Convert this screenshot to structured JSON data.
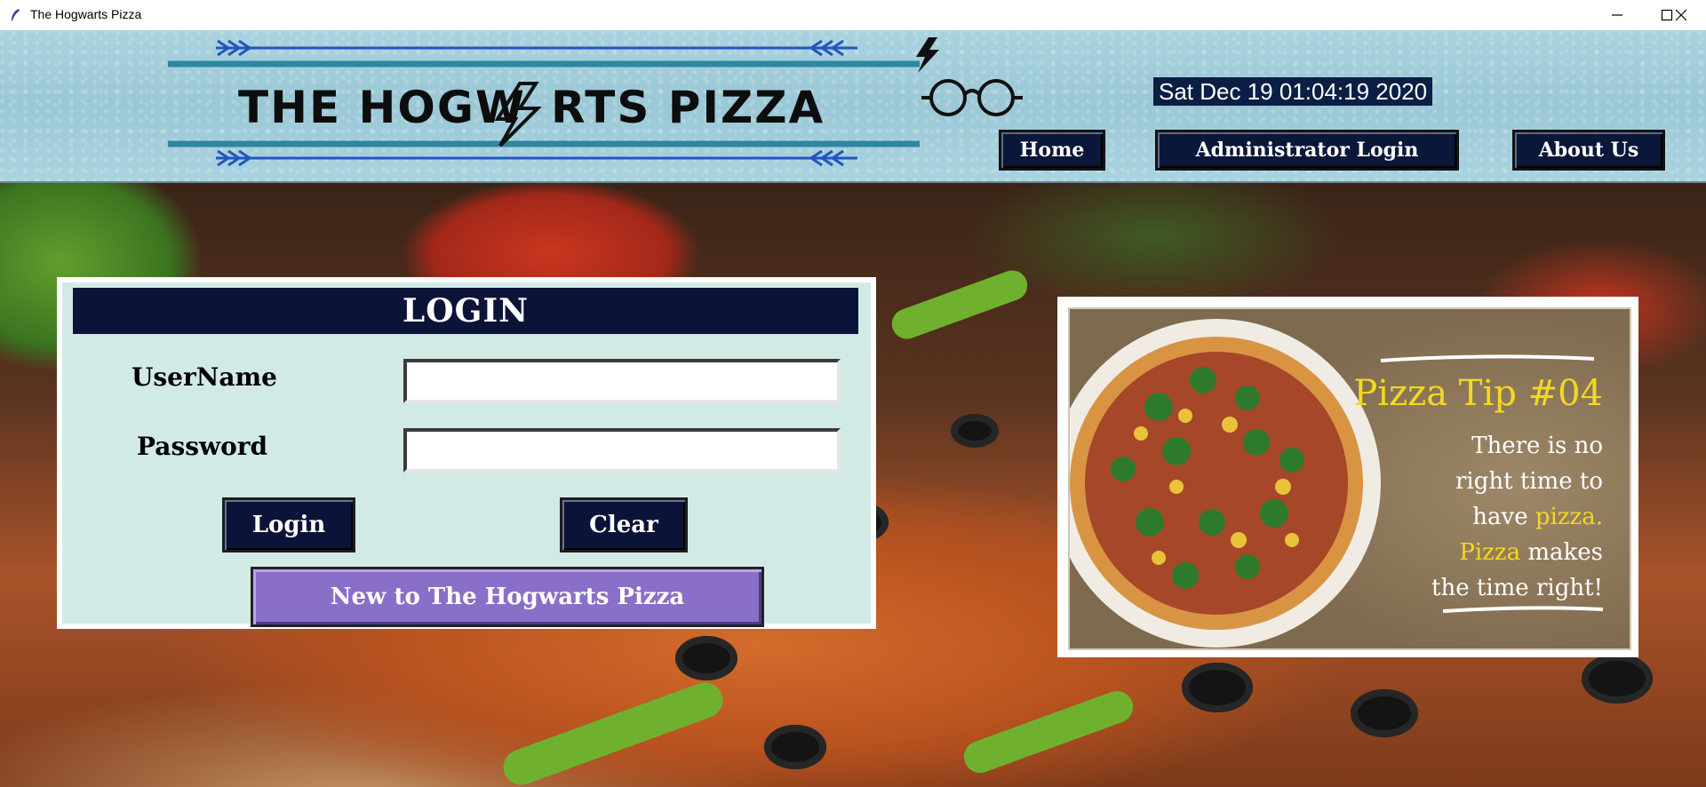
{
  "window": {
    "title": "The Hogwarts Pizza",
    "minimize_icon": "minimize-icon",
    "maximize_icon": "maximize-icon",
    "close_icon": "close-icon"
  },
  "header": {
    "logo_text_left": "THE HOGW",
    "logo_text_right": "RTS PIZZA",
    "clock": "Sat Dec 19 01:04:19 2020",
    "nav": {
      "home": "Home",
      "admin_login": "Administrator Login",
      "about_us": "About Us"
    }
  },
  "login": {
    "title": "LOGIN",
    "username_label": "UserName",
    "username_value": "",
    "password_label": "Password",
    "password_value": "",
    "login_button": "Login",
    "clear_button": "Clear",
    "register_button": "New to The Hogwarts Pizza"
  },
  "tip": {
    "title": "Pizza Tip #04",
    "line1": "There is no",
    "line2": "right time to",
    "line3_a": "have ",
    "line3_b": "pizza.",
    "line4_a": "Pizza",
    "line4_b": " makes",
    "line5": "the time right!"
  },
  "colors": {
    "navy": "#0b1339",
    "panel": "#d2eae6",
    "purple": "#8a6fc8",
    "tip_yellow": "#f4d820",
    "header": "#a8d2de"
  }
}
